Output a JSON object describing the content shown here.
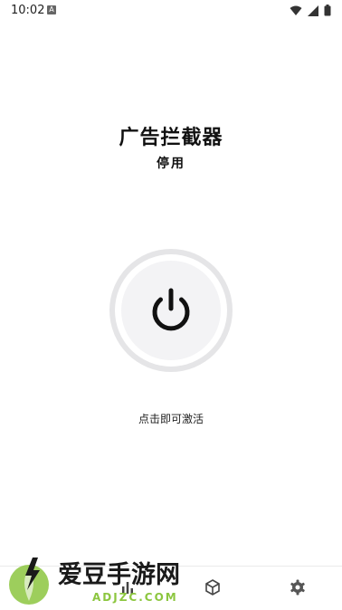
{
  "status_bar": {
    "time": "10:02",
    "notif_letter": "A"
  },
  "header": {
    "title": "广告拦截器",
    "state_label": "停用"
  },
  "power": {
    "icon": "power-icon"
  },
  "hint": "点击即可激活",
  "bottom_nav": {
    "items": [
      {
        "icon": "stats-icon"
      },
      {
        "icon": "box-icon"
      },
      {
        "icon": "gear-icon"
      }
    ]
  },
  "watermark": {
    "name": "爱豆手游网",
    "domain": "ADJZC.COM"
  },
  "colors": {
    "accent": "#111111",
    "ring": "#e5e5e7",
    "watermark_green": "#8cc63f"
  }
}
